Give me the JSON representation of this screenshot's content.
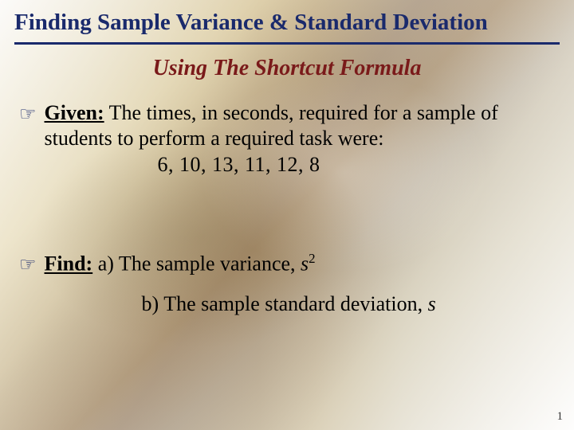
{
  "title": "Finding Sample Variance & Standard Deviation",
  "subtitle": "Using The Shortcut Formula",
  "bullet_glyph": "☞",
  "given": {
    "label": "Given:",
    "text": "  The times, in seconds, required for a sample of students to perform a required task were:",
    "data": "6,   10,   13,   11,   12,   8"
  },
  "find": {
    "label": "Find:",
    "a_prefix": "  a) The sample variance, ",
    "a_sym": "s",
    "a_sup": "2",
    "b_prefix": "b) The sample standard deviation, ",
    "b_sym": "s"
  },
  "page_number": "1"
}
